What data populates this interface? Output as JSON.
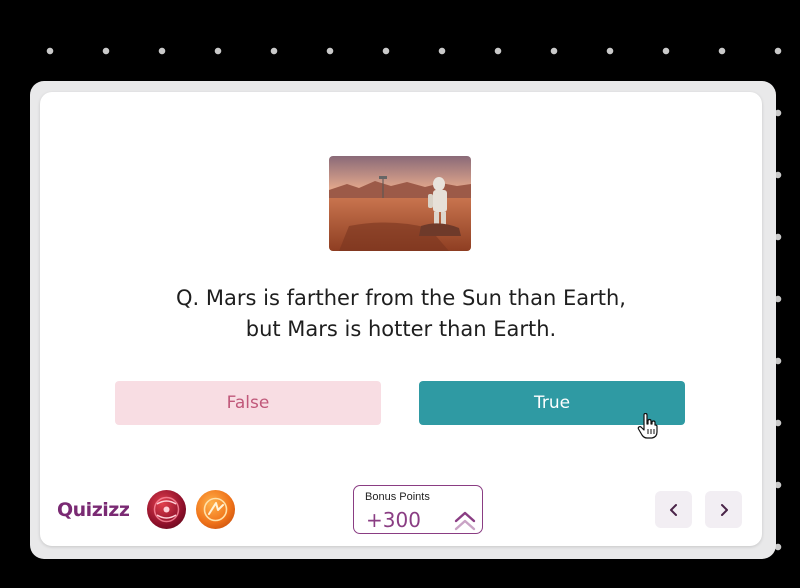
{
  "question": {
    "line1": "Q. Mars is farther from the Sun than Earth,",
    "line2": "but Mars is hotter than Earth."
  },
  "answers": {
    "false_label": "False",
    "true_label": "True"
  },
  "brand": {
    "logo_text": "Quizizz"
  },
  "bonus": {
    "label": "Bonus Points",
    "value": "+300"
  },
  "colors": {
    "true_button": "#2f9aa3",
    "false_button": "#f8dde3",
    "brand_purple": "#8a3d83"
  }
}
